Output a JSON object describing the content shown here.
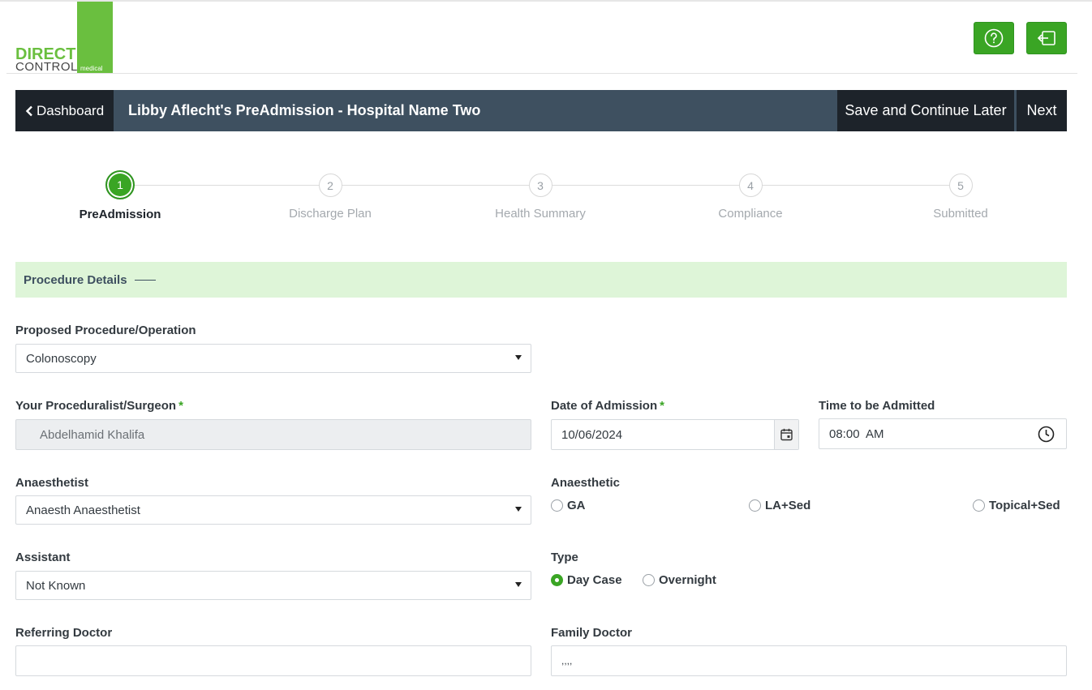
{
  "logo": {
    "word1": "DIRECT",
    "word2": "CONTROL",
    "word3": "medical"
  },
  "header": {
    "help_icon": "question-circle-icon",
    "logout_icon": "sign-out-icon"
  },
  "titlebar": {
    "back_label": "Dashboard",
    "title": "Libby Aflecht's PreAdmission - Hospital Name Two",
    "save_label": "Save and Continue Later",
    "next_label": "Next"
  },
  "steps": [
    {
      "number": "1",
      "label": "PreAdmission",
      "active": true
    },
    {
      "number": "2",
      "label": "Discharge Plan",
      "active": false
    },
    {
      "number": "3",
      "label": "Health Summary",
      "active": false
    },
    {
      "number": "4",
      "label": "Compliance",
      "active": false
    },
    {
      "number": "5",
      "label": "Submitted",
      "active": false
    }
  ],
  "section": {
    "title": "Procedure Details"
  },
  "form": {
    "procedure": {
      "label": "Proposed Procedure/Operation",
      "value": "Colonoscopy"
    },
    "surgeon": {
      "label": "Your Proceduralist/Surgeon",
      "required": "*",
      "value": "Abdelhamid Khalifa"
    },
    "admission_date": {
      "label": "Date of Admission",
      "required": "*",
      "value": "10/06/2024"
    },
    "admission_time": {
      "label": "Time to be Admitted",
      "value": "08:00  AM"
    },
    "anaesthetist": {
      "label": "Anaesthetist",
      "value": "Anaesth Anaesthetist"
    },
    "anaesthetic": {
      "label": "Anaesthetic",
      "options": [
        "GA",
        "LA+Sed",
        "Topical+Sed"
      ]
    },
    "assistant": {
      "label": "Assistant",
      "value": "Not Known"
    },
    "type": {
      "label": "Type",
      "options": [
        "Day Case",
        "Overnight"
      ],
      "selected": "Day Case"
    },
    "referring_doctor": {
      "label": "Referring Doctor",
      "value": ""
    },
    "family_doctor": {
      "label": "Family Doctor",
      "value": ",,,,"
    }
  }
}
